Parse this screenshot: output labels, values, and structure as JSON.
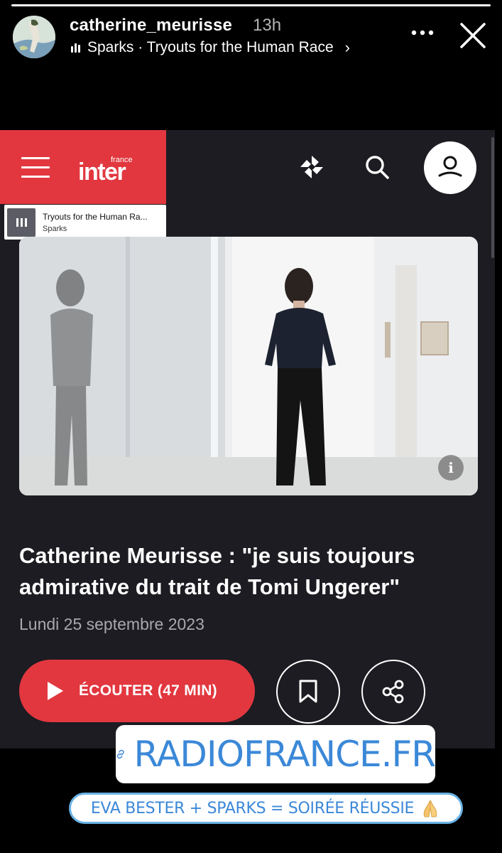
{
  "story": {
    "progress_fraction": 1.0,
    "username": "catherine_meurisse",
    "time_ago": "13h",
    "music_label": "Sparks · Tryouts for the Human Race",
    "music_chevron": "›",
    "more_icon": "ellipsis-icon",
    "close_icon": "close-icon"
  },
  "panel": {
    "brand_color": "#e2373f",
    "logo_small": "france",
    "logo_main": "inter",
    "icons": [
      "menu-icon",
      "radiofrance-logo-icon",
      "search-icon",
      "profile-icon"
    ],
    "mini_player": {
      "title": "Tryouts for the Human Ra...",
      "artist": "Sparks"
    },
    "info_glyph": "i",
    "article": {
      "title": "Catherine Meurisse : \"je suis toujours admirative du trait de Tomi Ungerer\"",
      "date": "Lundi 25 septembre 2023"
    },
    "listen_label": "ÉCOUTER (47 MIN)"
  },
  "stickers": {
    "link_text": "RADIOFRANCE.FR",
    "link_color": "#3b88d8",
    "text": "EVA BESTER + SPARKS = SOIRÉE RÉUSSIE",
    "emoji": "folded-hands-icon"
  }
}
